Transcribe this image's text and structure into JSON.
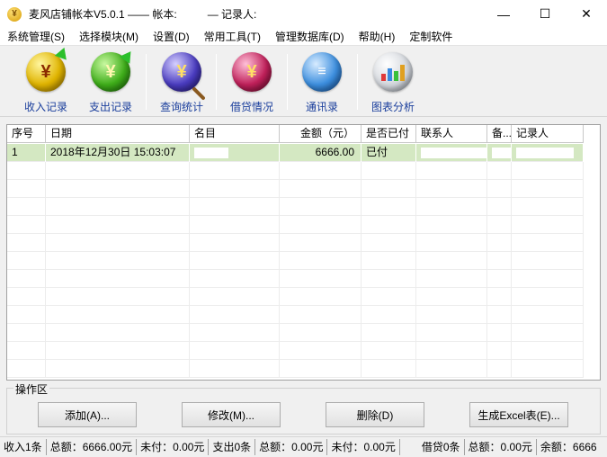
{
  "window": {
    "title": "麦风店铺帐本V5.0.1 —— 帐本:",
    "title_recorder": "— 记录人:",
    "minimize": "—",
    "maximize": "☐",
    "close": "✕"
  },
  "menu": [
    "系统管理(S)",
    "选择模块(M)",
    "设置(D)",
    "常用工具(T)",
    "管理数据库(D)",
    "帮助(H)",
    "定制软件"
  ],
  "toolbar": [
    {
      "label": "收入记录",
      "icon": "income-coin-icon",
      "glyph": "¥"
    },
    {
      "label": "支出记录",
      "icon": "expense-coin-icon",
      "glyph": "¥"
    },
    {
      "label": "查询统计",
      "icon": "query-magnifier-icon",
      "glyph": "¥"
    },
    {
      "label": "借贷情况",
      "icon": "loan-coin-icon",
      "glyph": "¥"
    },
    {
      "label": "通讯录",
      "icon": "contacts-book-icon",
      "glyph": "≡"
    },
    {
      "label": "图表分析",
      "icon": "chart-analysis-icon",
      "glyph": ""
    }
  ],
  "table": {
    "columns": [
      "序号",
      "日期",
      "名目",
      "金额（元）",
      "是否已付",
      "联系人",
      "备...",
      "记录人"
    ],
    "rows": [
      {
        "index": "1",
        "date": "2018年12月30日 15:03:07",
        "item": "",
        "amount": "6666.00",
        "paid": "已付",
        "contact": "",
        "note": "",
        "recorder": ""
      }
    ]
  },
  "operations": {
    "title": "操作区",
    "add": "添加(A)...",
    "edit": "修改(M)...",
    "delete": "删除(D)",
    "export": "生成Excel表(E)..."
  },
  "status": {
    "income_count": "收入1条",
    "income_total": "总额：6666.00元",
    "income_unpaid": "未付：0.00元",
    "expense_count": "支出0条",
    "expense_total": "总额：0.00元",
    "expense_unpaid": "未付：0.00元",
    "loan_count": "借贷0条",
    "loan_total": "总额：0.00元",
    "balance": "余额：6666"
  },
  "colors": {
    "selected_row": "#d4e8c2",
    "toolbar_label": "#1a3e9c"
  }
}
